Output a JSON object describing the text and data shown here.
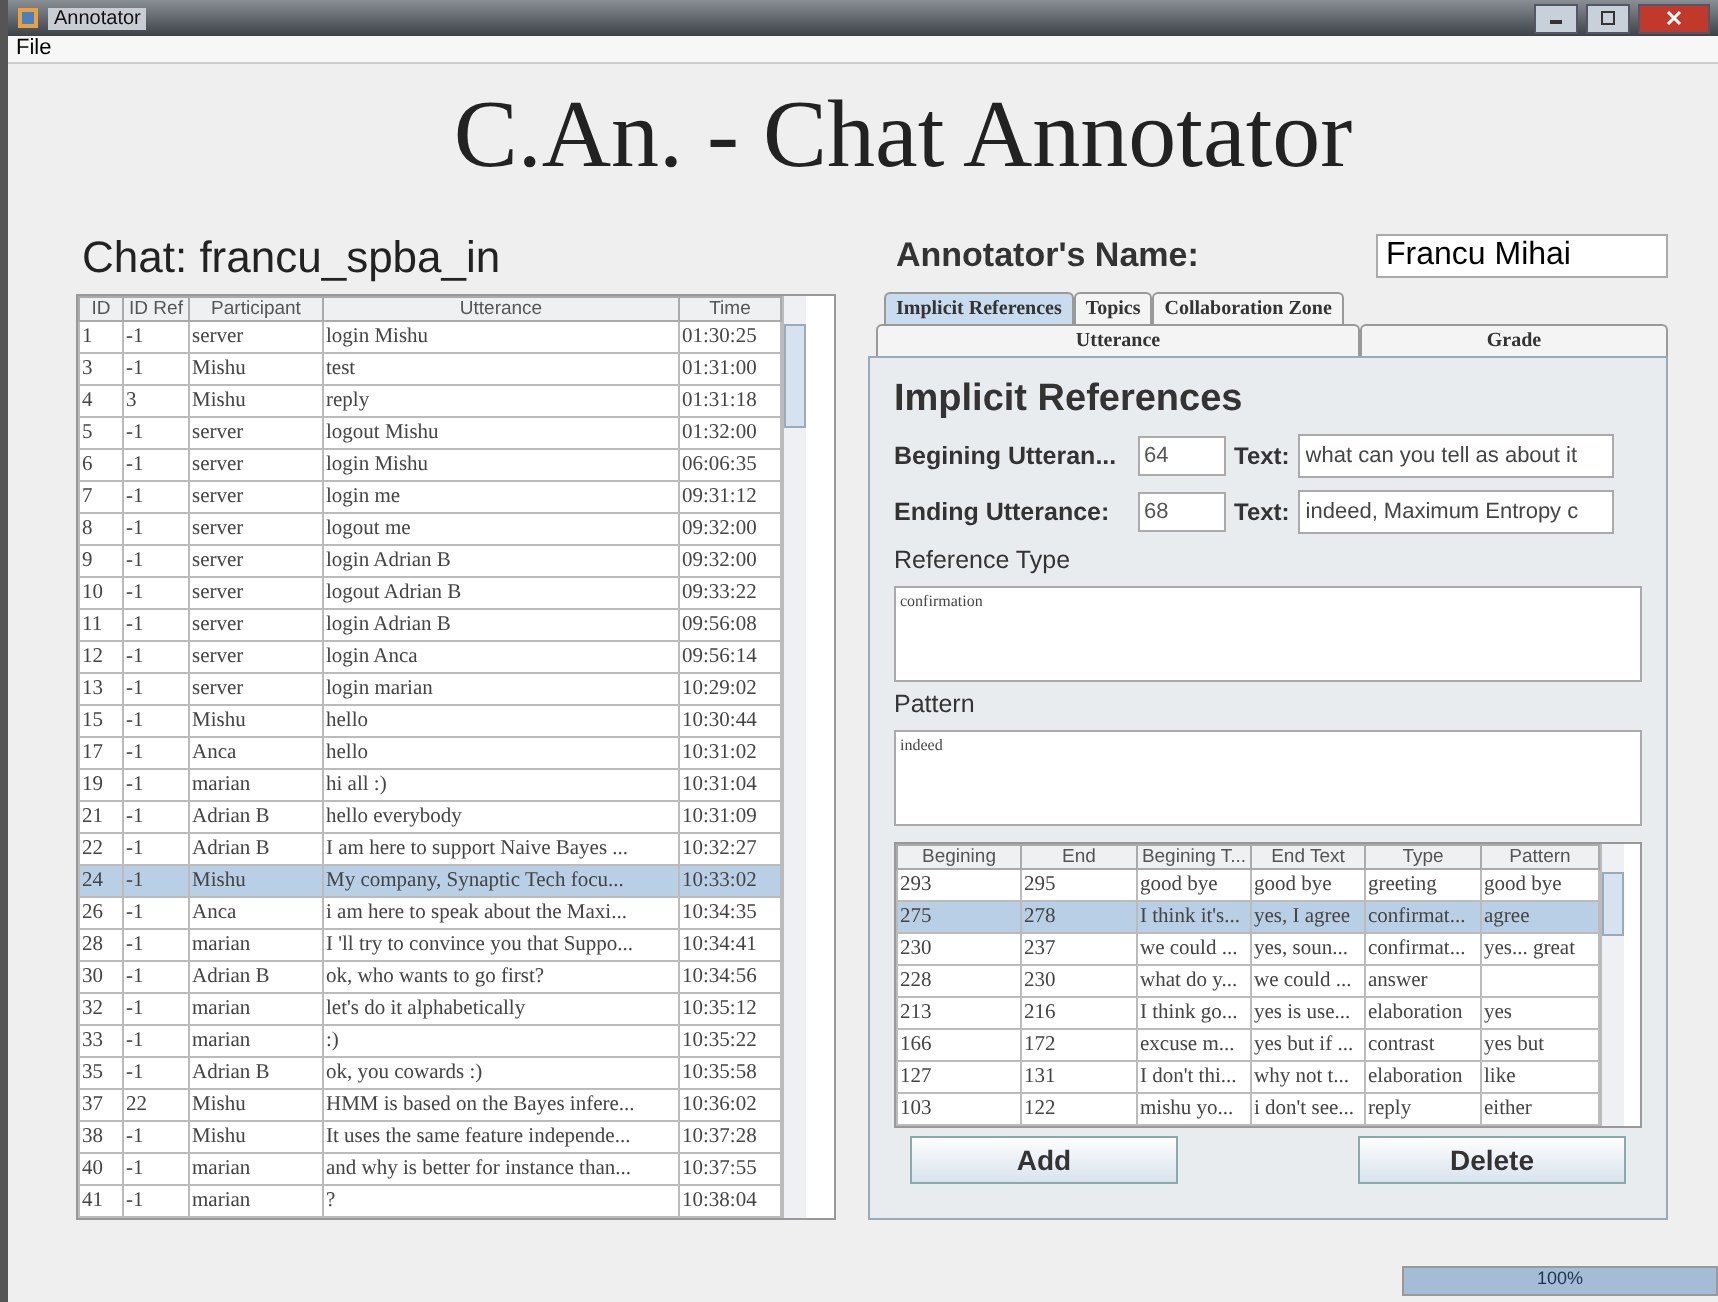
{
  "window": {
    "title": "Annotator"
  },
  "menu": [
    "File"
  ],
  "app_title": "C.An. - Chat Annotator",
  "chat": {
    "heading": "Chat: francu_spba_in",
    "columns": [
      "ID",
      "ID Ref",
      "Participant",
      "Utterance",
      "Time"
    ],
    "rows": [
      {
        "cells": [
          "1",
          "-1",
          "server",
          "login Mishu",
          "01:30:25"
        ],
        "selected": false
      },
      {
        "cells": [
          "3",
          "-1",
          "Mishu",
          "test",
          "01:31:00"
        ],
        "selected": false
      },
      {
        "cells": [
          "4",
          "3",
          "Mishu",
          "reply",
          "01:31:18"
        ],
        "selected": false
      },
      {
        "cells": [
          "5",
          "-1",
          "server",
          "logout Mishu",
          "01:32:00"
        ],
        "selected": false
      },
      {
        "cells": [
          "6",
          "-1",
          "server",
          "login Mishu",
          "06:06:35"
        ],
        "selected": false
      },
      {
        "cells": [
          "7",
          "-1",
          "server",
          "login me",
          "09:31:12"
        ],
        "selected": false
      },
      {
        "cells": [
          "8",
          "-1",
          "server",
          "logout me",
          "09:32:00"
        ],
        "selected": false
      },
      {
        "cells": [
          "9",
          "-1",
          "server",
          "login Adrian B",
          "09:32:00"
        ],
        "selected": false
      },
      {
        "cells": [
          "10",
          "-1",
          "server",
          "logout Adrian B",
          "09:33:22"
        ],
        "selected": false
      },
      {
        "cells": [
          "11",
          "-1",
          "server",
          "login Adrian B",
          "09:56:08"
        ],
        "selected": false
      },
      {
        "cells": [
          "12",
          "-1",
          "server",
          "login Anca",
          "09:56:14"
        ],
        "selected": false
      },
      {
        "cells": [
          "13",
          "-1",
          "server",
          "login marian",
          "10:29:02"
        ],
        "selected": false
      },
      {
        "cells": [
          "15",
          "-1",
          "Mishu",
          "hello",
          "10:30:44"
        ],
        "selected": false
      },
      {
        "cells": [
          "17",
          "-1",
          "Anca",
          "hello",
          "10:31:02"
        ],
        "selected": false
      },
      {
        "cells": [
          "19",
          "-1",
          "marian",
          "hi all :)",
          "10:31:04"
        ],
        "selected": false
      },
      {
        "cells": [
          "21",
          "-1",
          "Adrian B",
          "hello everybody",
          "10:31:09"
        ],
        "selected": false
      },
      {
        "cells": [
          "22",
          "-1",
          "Adrian B",
          "I am here to support Naive Bayes ...",
          "10:32:27"
        ],
        "selected": false
      },
      {
        "cells": [
          "24",
          "-1",
          "Mishu",
          "My company, Synaptic Tech focu...",
          "10:33:02"
        ],
        "selected": true
      },
      {
        "cells": [
          "26",
          "-1",
          "Anca",
          "i am here to speak about the Maxi...",
          "10:34:35"
        ],
        "selected": false
      },
      {
        "cells": [
          "28",
          "-1",
          "marian",
          "I 'll try to convince you that Suppo...",
          "10:34:41"
        ],
        "selected": false
      },
      {
        "cells": [
          "30",
          "-1",
          "Adrian B",
          "ok, who wants to go first?",
          "10:34:56"
        ],
        "selected": false
      },
      {
        "cells": [
          "32",
          "-1",
          "marian",
          "let's do it alphabetically",
          "10:35:12"
        ],
        "selected": false
      },
      {
        "cells": [
          "33",
          "-1",
          "marian",
          ":)",
          "10:35:22"
        ],
        "selected": false
      },
      {
        "cells": [
          "35",
          "-1",
          "Adrian B",
          "ok, you cowards :)",
          "10:35:58"
        ],
        "selected": false
      },
      {
        "cells": [
          "37",
          "22",
          "Mishu",
          "HMM is based on the Bayes infere...",
          "10:36:02"
        ],
        "selected": false
      },
      {
        "cells": [
          "38",
          "-1",
          "Mishu",
          "It uses the same feature independe...",
          "10:37:28"
        ],
        "selected": false
      },
      {
        "cells": [
          "40",
          "-1",
          "marian",
          "and why is better for instance than...",
          "10:37:55"
        ],
        "selected": false
      },
      {
        "cells": [
          "41",
          "-1",
          "marian",
          "?",
          "10:38:04"
        ],
        "selected": false
      }
    ]
  },
  "annotator": {
    "label": "Annotator's Name:",
    "value": "Francu Mihai"
  },
  "tabs": [
    {
      "label": "Implicit References",
      "selected": true
    },
    {
      "label": "Topics",
      "selected": false
    },
    {
      "label": "Collaboration Zone",
      "selected": false
    }
  ],
  "tabs_row2": [
    {
      "label": "Utterance",
      "selected": false
    },
    {
      "label": "Grade",
      "selected": false
    }
  ],
  "panel": {
    "heading": "Implicit References",
    "begin": {
      "label": "Begining Utteran...",
      "value": "64",
      "text_label": "Text:",
      "text_value": "what can you tell as about it"
    },
    "end": {
      "label": "Ending Utterance:",
      "value": "68",
      "text_label": "Text:",
      "text_value": "indeed, Maximum Entropy c"
    },
    "type_label": "Reference Type",
    "type_value": "confirmation",
    "pattern_label": "Pattern",
    "pattern_value": "indeed",
    "table": {
      "columns": [
        "Begining",
        "End",
        "Begining T...",
        "End Text",
        "Type",
        "Pattern"
      ],
      "rows": [
        {
          "cells": [
            "293",
            "295",
            "good bye",
            "good bye",
            "greeting",
            "good bye"
          ],
          "selected": false
        },
        {
          "cells": [
            "275",
            "278",
            "I think it's...",
            "yes, I agree",
            "confirmat...",
            "agree"
          ],
          "selected": true
        },
        {
          "cells": [
            "230",
            "237",
            "we could ...",
            "yes, soun...",
            "confirmat...",
            "yes... great"
          ],
          "selected": false
        },
        {
          "cells": [
            "228",
            "230",
            "what do y...",
            "we could ...",
            "answer",
            ""
          ],
          "selected": false
        },
        {
          "cells": [
            "213",
            "216",
            "I think go...",
            "yes is use...",
            "elaboration",
            "yes"
          ],
          "selected": false
        },
        {
          "cells": [
            "166",
            "172",
            "excuse m...",
            "yes but if ...",
            "contrast",
            "yes but"
          ],
          "selected": false
        },
        {
          "cells": [
            "127",
            "131",
            "I don't thi...",
            "why not t...",
            "elaboration",
            "like"
          ],
          "selected": false
        },
        {
          "cells": [
            "103",
            "122",
            "mishu yo...",
            "i don't see...",
            "reply",
            "either"
          ],
          "selected": false
        }
      ]
    },
    "buttons": [
      "Add",
      "Delete"
    ]
  },
  "progress": {
    "label": "100%",
    "level": 1
  }
}
